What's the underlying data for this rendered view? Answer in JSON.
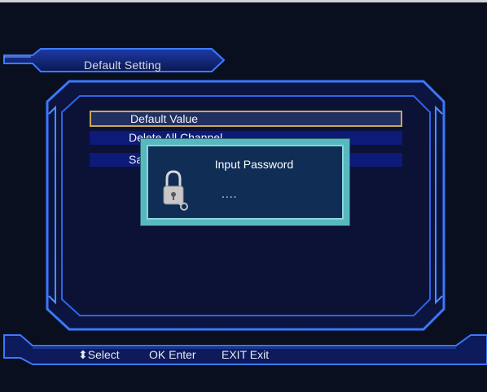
{
  "window": {
    "title": "Default Setting"
  },
  "menu": {
    "items": [
      {
        "label": "Default Value",
        "state": "selected"
      },
      {
        "label": "Delete All Channel",
        "state": "normal"
      },
      {
        "label": "Save",
        "state": "normal"
      }
    ]
  },
  "dialog": {
    "title": "Input Password",
    "value": "....",
    "icon": "lock-icon"
  },
  "footer": {
    "select_icon": "up-down-arrows-icon",
    "select_label": "Select",
    "ok_key": "OK",
    "ok_label": "Enter",
    "exit_key": "EXIT",
    "exit_label": "Exit"
  },
  "colors": {
    "background": "#0a0f1f",
    "frame_line": "#2f6ef0",
    "frame_glow": "#4a90ff",
    "selection_border": "#c8a85a",
    "item_fill": "#0d1a78",
    "dialog_outer": "#58b8c0",
    "dialog_inner": "#0f2d55"
  }
}
